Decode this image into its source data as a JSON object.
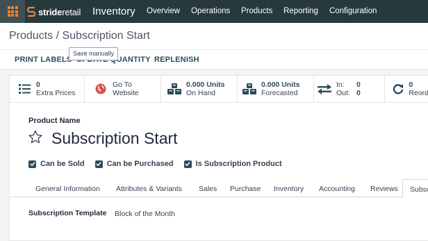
{
  "brand": {
    "logo_bold": "stride",
    "logo_light": "retail",
    "accent": "#e8883b",
    "nav_bg": "#263a3d",
    "primary": "#2b4d5c"
  },
  "app_title": "Inventory",
  "nav": [
    "Overview",
    "Operations",
    "Products",
    "Reporting",
    "Configuration"
  ],
  "breadcrumb": "Products / Subscription Start",
  "tooltip": "Save manually",
  "actions": {
    "print_labels": "PRINT LABELS",
    "update_quantity": "UPDATE QUANTITY",
    "replenish": "REPLENISH"
  },
  "smart_buttons": {
    "extra_prices": {
      "value": "0",
      "label": "Extra Prices",
      "icon": "list-icon"
    },
    "website": {
      "line1": "Go To",
      "line2": "Website",
      "icon": "globe-icon"
    },
    "on_hand": {
      "value": "0.000 Units",
      "label": "On Hand",
      "icon": "cubes-icon"
    },
    "forecasted": {
      "value": "0.000 Units",
      "label": "Forecasted",
      "icon": "cubes-icon"
    },
    "in_out": {
      "in_label": "In:",
      "in_value": "0",
      "out_label": "Out:",
      "out_value": "0",
      "icon": "exchange-icon"
    },
    "reorder": {
      "value": "0",
      "label": "Reord",
      "icon": "refresh-icon"
    }
  },
  "product": {
    "name_label": "Product Name",
    "name": "Subscription Start"
  },
  "checkboxes": [
    {
      "label": "Can be Sold",
      "checked": true
    },
    {
      "label": "Can be Purchased",
      "checked": true
    },
    {
      "label": "Is Subscription Product",
      "checked": true
    }
  ],
  "tabs": [
    "General Information",
    "Attributes & Variants",
    "Sales",
    "Purchase",
    "Inventory",
    "Accounting",
    "Reviews",
    "Subsc"
  ],
  "subscription": {
    "template_label": "Subscription Template",
    "template_value": "Block of the Month"
  }
}
